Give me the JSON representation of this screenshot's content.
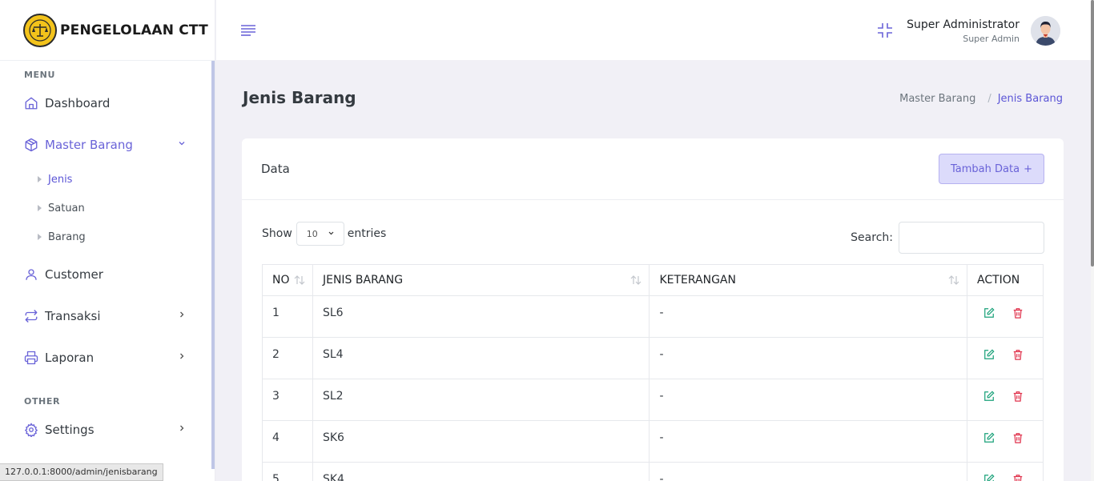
{
  "brand": {
    "name": "PENGELOLAAN CTT"
  },
  "sidebar": {
    "menu_title": "MENU",
    "other_title": "OTHER",
    "items": [
      {
        "label": "Dashboard",
        "icon": "home-icon"
      },
      {
        "label": "Master Barang",
        "icon": "box-icon"
      },
      {
        "label": "Customer",
        "icon": "user-icon"
      },
      {
        "label": "Transaksi",
        "icon": "repeat-icon"
      },
      {
        "label": "Laporan",
        "icon": "printer-icon"
      },
      {
        "label": "Settings",
        "icon": "gear-icon"
      }
    ],
    "sub_items": [
      {
        "label": "Jenis"
      },
      {
        "label": "Satuan"
      },
      {
        "label": "Barang"
      }
    ]
  },
  "header": {
    "user_name": "Super Administrator",
    "user_role": "Super Admin"
  },
  "page": {
    "title": "Jenis Barang",
    "breadcrumb": [
      "Master Barang",
      "/",
      "Jenis Barang"
    ]
  },
  "card": {
    "title": "Data",
    "add_button": "Tambah Data",
    "add_icon": "+",
    "show_label": "Show",
    "entries_label": "entries",
    "page_size": "10",
    "search_label": "Search:",
    "search_value": ""
  },
  "table": {
    "headers": [
      "NO",
      "JENIS BARANG",
      "KETERANGAN",
      "ACTION"
    ],
    "rows": [
      {
        "no": "1",
        "jenis": "SL6",
        "ket": "-"
      },
      {
        "no": "2",
        "jenis": "SL4",
        "ket": "-"
      },
      {
        "no": "3",
        "jenis": "SL2",
        "ket": "-"
      },
      {
        "no": "4",
        "jenis": "SK6",
        "ket": "-"
      },
      {
        "no": "5",
        "jenis": "SK4",
        "ket": "-"
      }
    ]
  },
  "status_url": "127.0.0.1:8000/admin/jenisbarang",
  "colors": {
    "accent": "#6a63d8",
    "edit": "#1aa179",
    "delete": "#e0314b"
  }
}
